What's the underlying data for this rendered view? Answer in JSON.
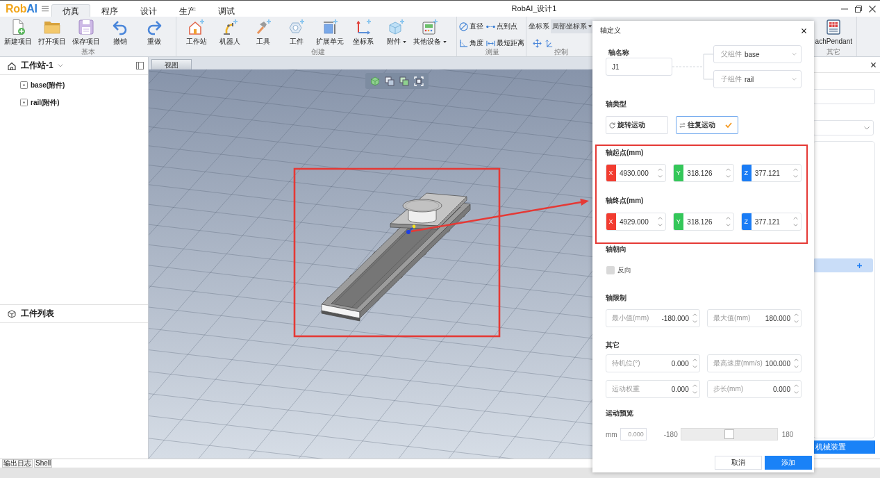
{
  "app": {
    "logo": [
      {
        "text": "Rob",
        "color": "#f2a51a"
      },
      {
        "text": "AI",
        "color": "#2f7fd8"
      }
    ],
    "title": "RobAI_设计1"
  },
  "menu_tabs": [
    {
      "label": "仿真",
      "selected": true
    },
    {
      "label": "程序",
      "selected": false
    },
    {
      "label": "设计",
      "selected": false
    },
    {
      "label": "生产",
      "selected": false
    },
    {
      "label": "调试",
      "selected": false
    }
  ],
  "ribbon": {
    "groups": [
      {
        "kind": "large",
        "label": "基本",
        "buttons": [
          {
            "label": "新建项目",
            "dropdown": false
          },
          {
            "label": "打开项目",
            "dropdown": false
          },
          {
            "label": "保存项目",
            "dropdown": false
          },
          {
            "label": "撤销",
            "dropdown": false
          },
          {
            "label": "重做",
            "dropdown": false
          }
        ]
      },
      {
        "kind": "large",
        "label": "创建",
        "buttons": [
          {
            "label": "工作站",
            "dropdown": false
          },
          {
            "label": "机器人",
            "dropdown": false
          },
          {
            "label": "工具",
            "dropdown": false
          },
          {
            "label": "工件",
            "dropdown": false
          },
          {
            "label": "扩展单元",
            "dropdown": false
          },
          {
            "label": "坐标系",
            "dropdown": false
          },
          {
            "label": "附件",
            "dropdown": true
          },
          {
            "label": "其他设备",
            "dropdown": true
          }
        ]
      },
      {
        "kind": "small",
        "label": "测量",
        "buttons": [
          {
            "label": "直径"
          },
          {
            "label": "点到点"
          },
          {
            "label": "角度"
          },
          {
            "label": "最短距离"
          }
        ]
      },
      {
        "kind": "control",
        "label": "控制",
        "field_label": "坐标系",
        "select_value": "局部坐标系"
      },
      {
        "kind": "large",
        "label": "其它",
        "buttons": [
          {
            "label": "achPendant",
            "dropdown": false
          }
        ]
      }
    ]
  },
  "station_panel": {
    "title": "工作站-1",
    "tree": [
      {
        "label": "base(附件)"
      },
      {
        "label": "rail(附件)"
      }
    ]
  },
  "workpiece_panel": {
    "title": "工件列表"
  },
  "viewport": {
    "tab": "视图"
  },
  "side_panel": {
    "button": "机械装置"
  },
  "bottom_tabs": [
    {
      "label": "输出日志"
    },
    {
      "label": "Shell"
    }
  ],
  "axis_dialog": {
    "title": "轴定义",
    "name_label": "轴名称",
    "name_value": "J1",
    "parent_select": {
      "label": "父组件",
      "value": "base"
    },
    "child_select": {
      "label": "子组件",
      "value": "rail"
    },
    "type_label": "轴类型",
    "type_options": [
      {
        "label": "旋转运动",
        "selected": false
      },
      {
        "label": "往复运动",
        "selected": true
      }
    ],
    "start_point": {
      "label": "轴起点(mm)",
      "coords": [
        {
          "axis": "X",
          "value": "4930.000",
          "color": "#f23c30"
        },
        {
          "axis": "Y",
          "value": "318.126",
          "color": "#34c759"
        },
        {
          "axis": "Z",
          "value": "377.121",
          "color": "#1a7cf5"
        }
      ]
    },
    "end_point": {
      "label": "轴终点(mm)",
      "coords": [
        {
          "axis": "X",
          "value": "4929.000",
          "color": "#f23c30"
        },
        {
          "axis": "Y",
          "value": "318.126",
          "color": "#34c759"
        },
        {
          "axis": "Z",
          "value": "377.121",
          "color": "#1a7cf5"
        }
      ]
    },
    "direction": {
      "label": "轴朝向",
      "option": {
        "label": "反向",
        "checked": false
      }
    },
    "limits": {
      "label": "轴限制",
      "fields": [
        {
          "label": "最小值(mm)",
          "value": "-180.000"
        },
        {
          "label": "最大值(mm)",
          "value": "180.000"
        }
      ]
    },
    "other": {
      "label": "其它",
      "fields": [
        {
          "label": "待机位(°)",
          "value": "0.000"
        },
        {
          "label": "最高速度(mm/s)",
          "value": "100.000"
        },
        {
          "label": "运动权重",
          "value": "0.000"
        },
        {
          "label": "步长(mm)",
          "value": "0.000"
        }
      ]
    },
    "preview": {
      "label": "运动预览",
      "unit": "mm",
      "placeholder": "0.000",
      "min": "-180",
      "max": "180",
      "level": 0.5
    },
    "buttons": [
      {
        "label": "取消",
        "kind": "secondary"
      },
      {
        "label": "添加",
        "kind": "primary"
      }
    ]
  }
}
